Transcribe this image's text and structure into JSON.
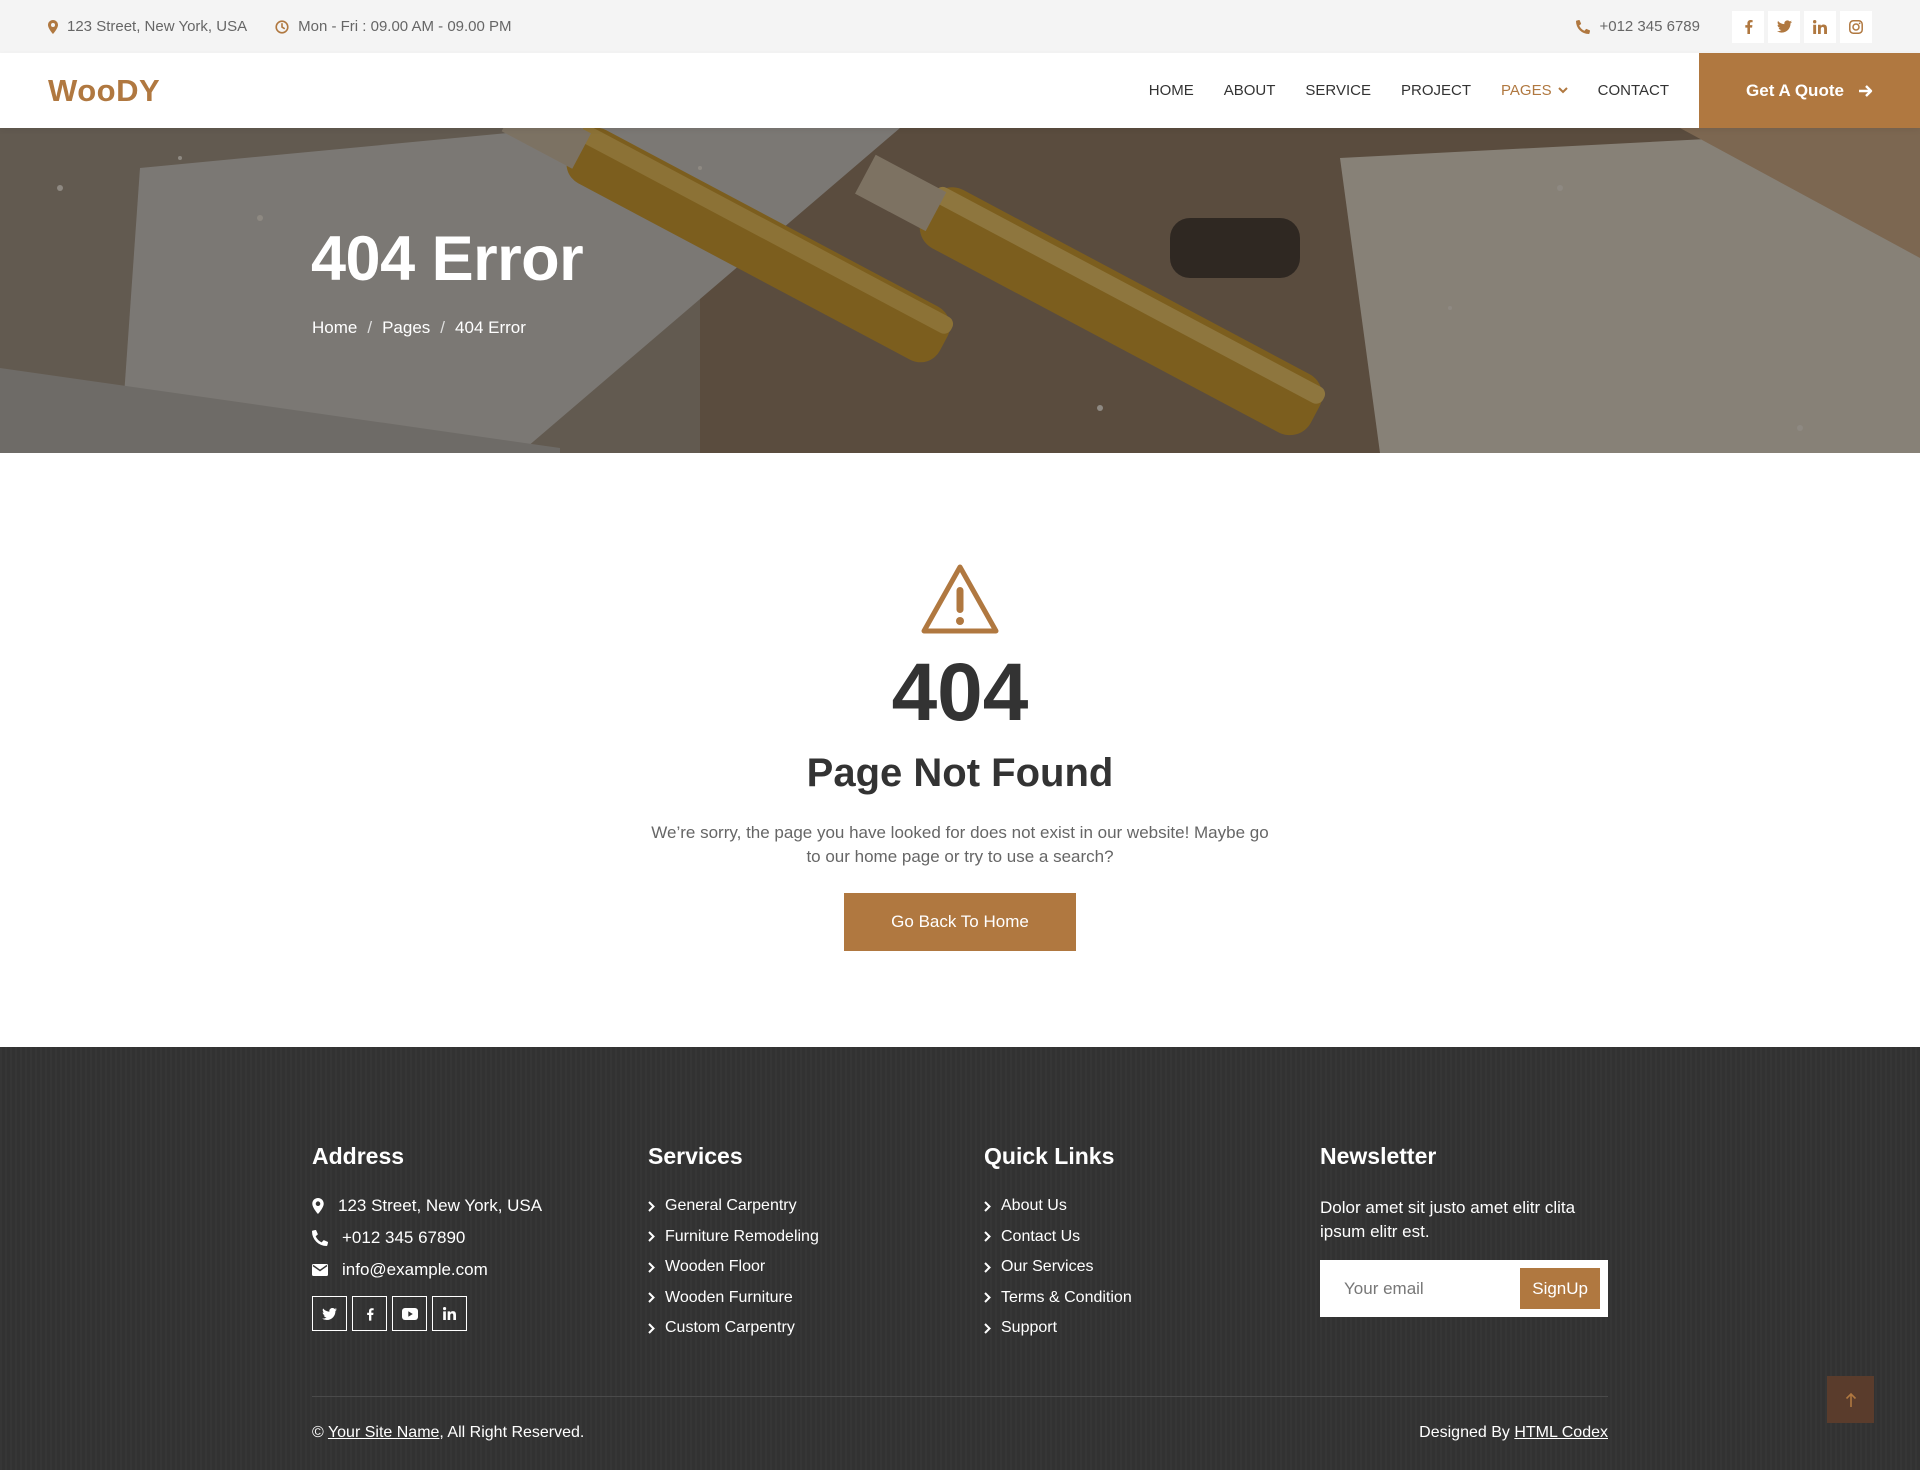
{
  "topbar": {
    "address": "123 Street, New York, USA",
    "hours": "Mon - Fri : 09.00 AM - 09.00 PM",
    "phone": "+012 345 6789"
  },
  "navbar": {
    "brand": "WooDY",
    "menu": [
      "HOME",
      "ABOUT",
      "SERVICE",
      "PROJECT",
      "PAGES",
      "CONTACT"
    ],
    "active": "PAGES",
    "quote_label": "Get A Quote"
  },
  "hero": {
    "title": "404 Error",
    "breadcrumb": [
      "Home",
      "Pages",
      "404 Error"
    ],
    "separator": "/"
  },
  "error": {
    "code": "404",
    "heading": "Page Not Found",
    "message": "We’re sorry, the page you have looked for does not exist in our website! Maybe go to our home page or try to use a search?",
    "button": "Go Back To Home"
  },
  "footer": {
    "address": {
      "heading": "Address",
      "street": "123 Street, New York, USA",
      "phone": "+012 345 67890",
      "email": "info@example.com"
    },
    "services": {
      "heading": "Services",
      "items": [
        "General Carpentry",
        "Furniture Remodeling",
        "Wooden Floor",
        "Wooden Furniture",
        "Custom Carpentry"
      ]
    },
    "quick_links": {
      "heading": "Quick Links",
      "items": [
        "About Us",
        "Contact Us",
        "Our Services",
        "Terms & Condition",
        "Support"
      ]
    },
    "newsletter": {
      "heading": "Newsletter",
      "text": "Dolor amet sit justo amet elitr clita ipsum elitr est.",
      "placeholder": "Your email",
      "button": "SignUp"
    },
    "copyright_prefix": "©",
    "site_name": "Your Site Name",
    "copyright_suffix": ", All Right Reserved.",
    "designed_by_prefix": "Designed By",
    "designer": "HTML Codex"
  },
  "colors": {
    "accent": "#b07840",
    "footer_bg": "#333333",
    "topbar_bg": "#f4f4f4"
  },
  "icons": [
    "map-marker-icon",
    "clock-icon",
    "phone-icon",
    "facebook-icon",
    "twitter-icon",
    "linkedin-icon",
    "instagram-icon",
    "arrow-right-icon",
    "chevron-down-icon",
    "warning-icon",
    "envelope-icon",
    "youtube-icon",
    "chevron-right-icon",
    "arrow-up-icon"
  ]
}
